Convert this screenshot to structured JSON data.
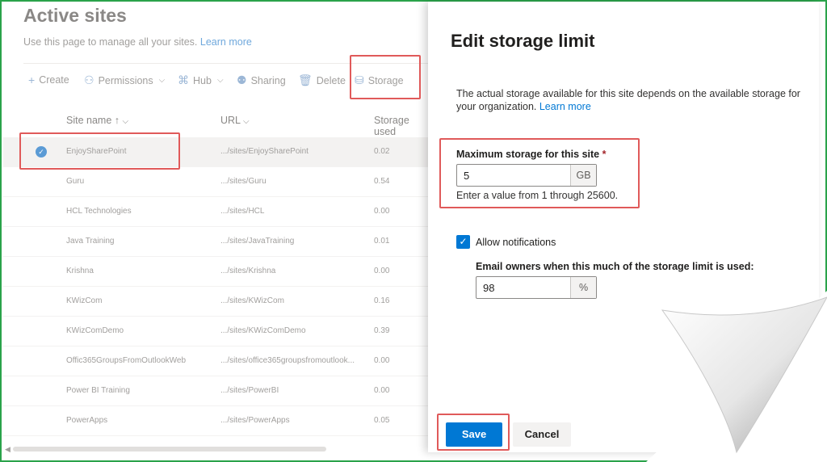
{
  "page": {
    "title": "Active sites",
    "description": "Use this page to manage all your sites.",
    "learn_more": "Learn more"
  },
  "commands": [
    {
      "label": "Create",
      "icon": "plus-icon"
    },
    {
      "label": "Permissions",
      "icon": "people-icon"
    },
    {
      "label": "Hub",
      "icon": "hub-icon"
    },
    {
      "label": "Sharing",
      "icon": "sharing-icon"
    },
    {
      "label": "Delete",
      "icon": "trash-icon"
    },
    {
      "label": "Storage",
      "icon": "storage-icon"
    }
  ],
  "table": {
    "columns": [
      "Site name ↑",
      "URL",
      "Storage used"
    ],
    "rows": [
      {
        "name": "EnjoySharePoint",
        "url": ".../sites/EnjoySharePoint",
        "storage": "0.02",
        "selected": true
      },
      {
        "name": "Guru",
        "url": ".../sites/Guru",
        "storage": "0.54"
      },
      {
        "name": "HCL Technologies",
        "url": ".../sites/HCL",
        "storage": "0.00"
      },
      {
        "name": "Java Training",
        "url": ".../sites/JavaTraining",
        "storage": "0.01"
      },
      {
        "name": "Krishna",
        "url": ".../sites/Krishna",
        "storage": "0.00"
      },
      {
        "name": "KWizCom",
        "url": ".../sites/KWizCom",
        "storage": "0.16"
      },
      {
        "name": "KWizComDemo",
        "url": ".../sites/KWizComDemo",
        "storage": "0.39"
      },
      {
        "name": "Offic365GroupsFromOutlookWeb",
        "url": ".../sites/office365groupsfromoutlook...",
        "storage": "0.00"
      },
      {
        "name": "Power BI Training",
        "url": ".../sites/PowerBI",
        "storage": "0.00"
      },
      {
        "name": "PowerApps",
        "url": ".../sites/PowerApps",
        "storage": "0.05"
      }
    ]
  },
  "panel": {
    "title": "Edit storage limit",
    "description": "The actual storage available for this site depends on the available storage for your organization.",
    "learn_more": "Learn more",
    "max_label": "Maximum storage for this site",
    "required_mark": "*",
    "max_value": "5",
    "max_unit": "GB",
    "max_hint": "Enter a value from 1 through 25600.",
    "notify_label": "Allow notifications",
    "notify_checked": true,
    "email_label": "Email owners when this much of the storage limit is used:",
    "email_value": "98",
    "email_unit": "%",
    "save": "Save",
    "cancel": "Cancel"
  },
  "colors": {
    "accent": "#0078d4",
    "highlight": "#e05a5a",
    "frame": "#2aa34a"
  }
}
